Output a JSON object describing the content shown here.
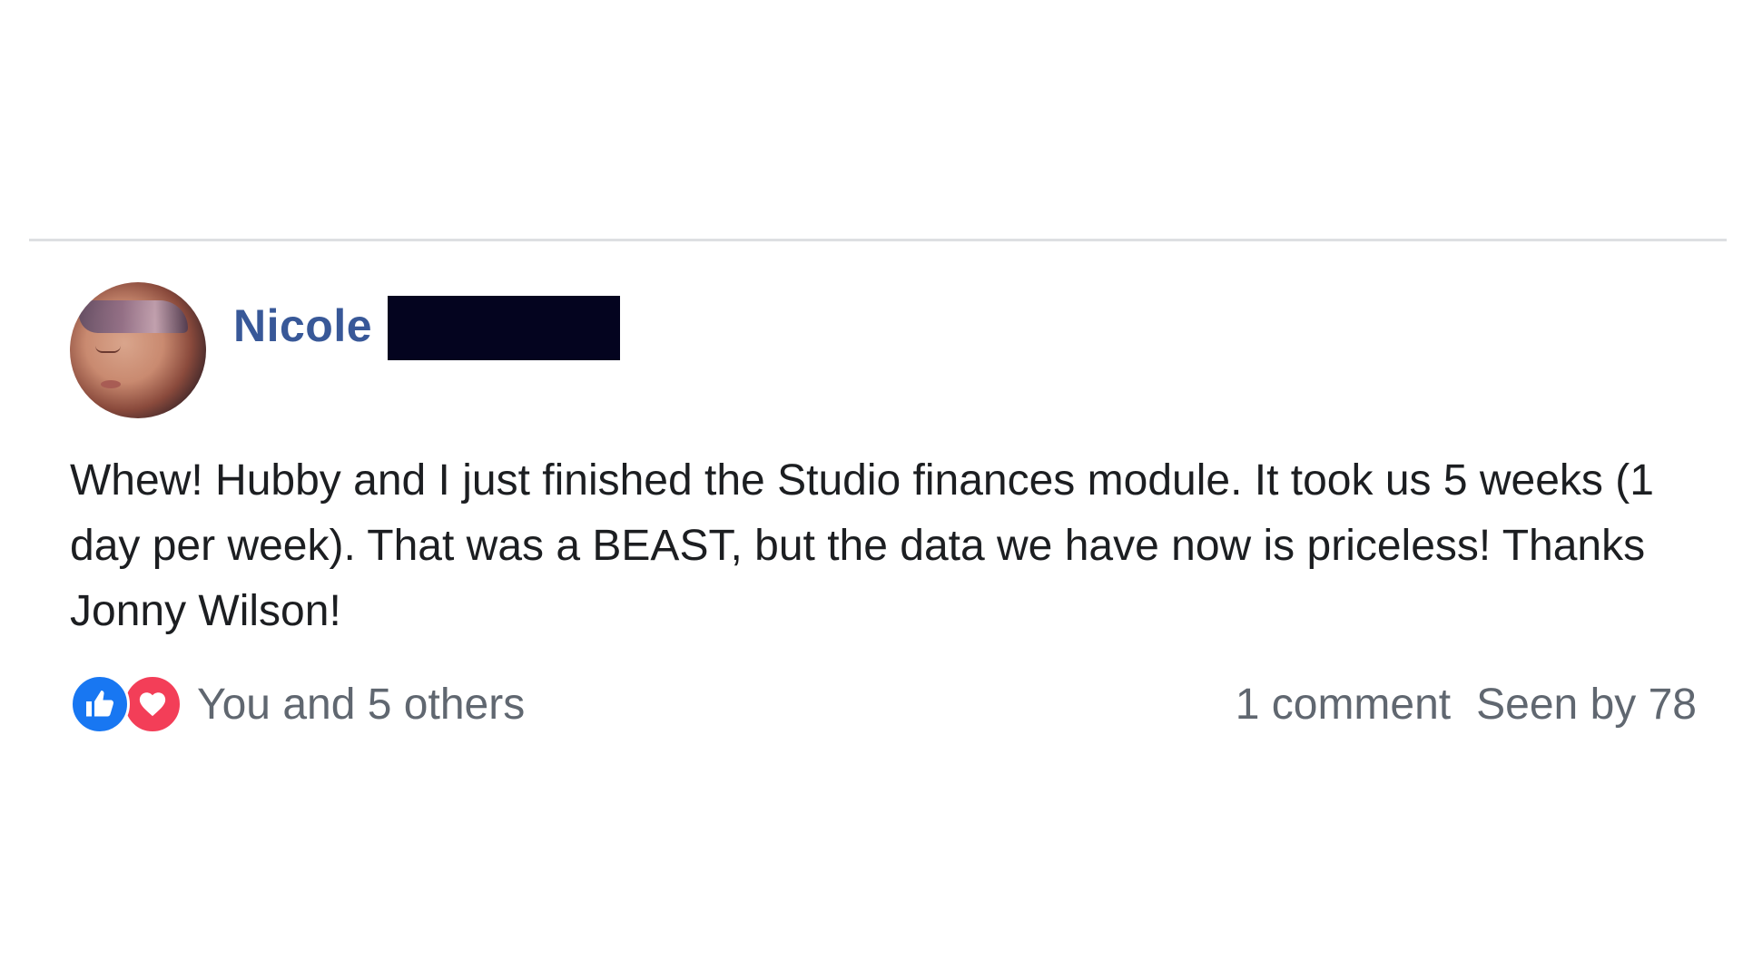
{
  "post": {
    "author": {
      "first_name": "Nicole",
      "last_name_redacted": true
    },
    "avatar_icon": "avatar-photo",
    "text": "Whew! Hubby and I just finished the Studio finances module. It took us 5 weeks (1 day per week). That was a BEAST, but the data we have now is priceless! Thanks Jonny Wilson!",
    "reactions": {
      "icons": [
        "like-icon",
        "love-icon"
      ],
      "summary": "You and 5 others"
    },
    "comments_label": "1 comment",
    "seen_label": "Seen by 78"
  },
  "colors": {
    "author_name": "#385898",
    "body_text": "#1c1e21",
    "meta_text": "#606770",
    "like_blue": "#1877f2",
    "love_red": "#f33e58",
    "redaction": "#04041f",
    "divider": "#dddfe2"
  }
}
